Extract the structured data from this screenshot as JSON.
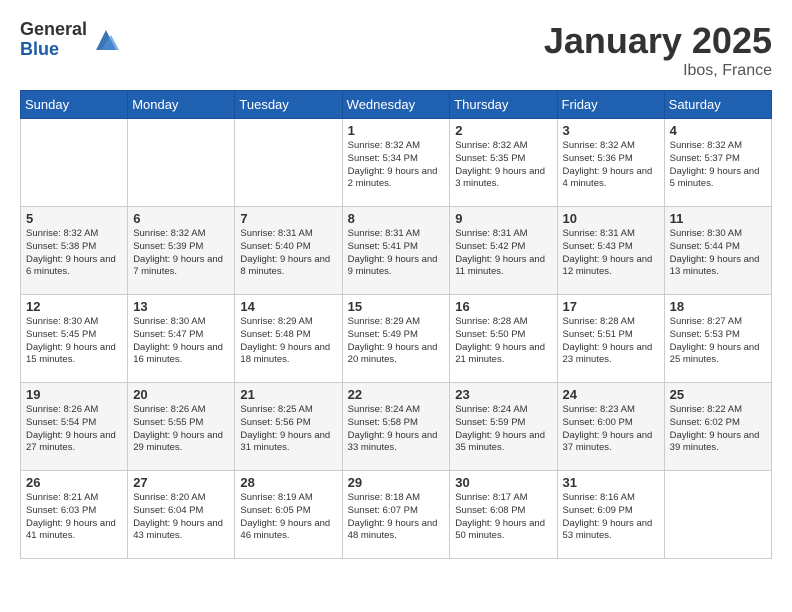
{
  "header": {
    "logo_general": "General",
    "logo_blue": "Blue",
    "month": "January 2025",
    "location": "Ibos, France"
  },
  "days_of_week": [
    "Sunday",
    "Monday",
    "Tuesday",
    "Wednesday",
    "Thursday",
    "Friday",
    "Saturday"
  ],
  "weeks": [
    [
      {
        "day": "",
        "info": ""
      },
      {
        "day": "",
        "info": ""
      },
      {
        "day": "",
        "info": ""
      },
      {
        "day": "1",
        "info": "Sunrise: 8:32 AM\nSunset: 5:34 PM\nDaylight: 9 hours\nand 2 minutes."
      },
      {
        "day": "2",
        "info": "Sunrise: 8:32 AM\nSunset: 5:35 PM\nDaylight: 9 hours\nand 3 minutes."
      },
      {
        "day": "3",
        "info": "Sunrise: 8:32 AM\nSunset: 5:36 PM\nDaylight: 9 hours\nand 4 minutes."
      },
      {
        "day": "4",
        "info": "Sunrise: 8:32 AM\nSunset: 5:37 PM\nDaylight: 9 hours\nand 5 minutes."
      }
    ],
    [
      {
        "day": "5",
        "info": "Sunrise: 8:32 AM\nSunset: 5:38 PM\nDaylight: 9 hours\nand 6 minutes."
      },
      {
        "day": "6",
        "info": "Sunrise: 8:32 AM\nSunset: 5:39 PM\nDaylight: 9 hours\nand 7 minutes."
      },
      {
        "day": "7",
        "info": "Sunrise: 8:31 AM\nSunset: 5:40 PM\nDaylight: 9 hours\nand 8 minutes."
      },
      {
        "day": "8",
        "info": "Sunrise: 8:31 AM\nSunset: 5:41 PM\nDaylight: 9 hours\nand 9 minutes."
      },
      {
        "day": "9",
        "info": "Sunrise: 8:31 AM\nSunset: 5:42 PM\nDaylight: 9 hours\nand 11 minutes."
      },
      {
        "day": "10",
        "info": "Sunrise: 8:31 AM\nSunset: 5:43 PM\nDaylight: 9 hours\nand 12 minutes."
      },
      {
        "day": "11",
        "info": "Sunrise: 8:30 AM\nSunset: 5:44 PM\nDaylight: 9 hours\nand 13 minutes."
      }
    ],
    [
      {
        "day": "12",
        "info": "Sunrise: 8:30 AM\nSunset: 5:45 PM\nDaylight: 9 hours\nand 15 minutes."
      },
      {
        "day": "13",
        "info": "Sunrise: 8:30 AM\nSunset: 5:47 PM\nDaylight: 9 hours\nand 16 minutes."
      },
      {
        "day": "14",
        "info": "Sunrise: 8:29 AM\nSunset: 5:48 PM\nDaylight: 9 hours\nand 18 minutes."
      },
      {
        "day": "15",
        "info": "Sunrise: 8:29 AM\nSunset: 5:49 PM\nDaylight: 9 hours\nand 20 minutes."
      },
      {
        "day": "16",
        "info": "Sunrise: 8:28 AM\nSunset: 5:50 PM\nDaylight: 9 hours\nand 21 minutes."
      },
      {
        "day": "17",
        "info": "Sunrise: 8:28 AM\nSunset: 5:51 PM\nDaylight: 9 hours\nand 23 minutes."
      },
      {
        "day": "18",
        "info": "Sunrise: 8:27 AM\nSunset: 5:53 PM\nDaylight: 9 hours\nand 25 minutes."
      }
    ],
    [
      {
        "day": "19",
        "info": "Sunrise: 8:26 AM\nSunset: 5:54 PM\nDaylight: 9 hours\nand 27 minutes."
      },
      {
        "day": "20",
        "info": "Sunrise: 8:26 AM\nSunset: 5:55 PM\nDaylight: 9 hours\nand 29 minutes."
      },
      {
        "day": "21",
        "info": "Sunrise: 8:25 AM\nSunset: 5:56 PM\nDaylight: 9 hours\nand 31 minutes."
      },
      {
        "day": "22",
        "info": "Sunrise: 8:24 AM\nSunset: 5:58 PM\nDaylight: 9 hours\nand 33 minutes."
      },
      {
        "day": "23",
        "info": "Sunrise: 8:24 AM\nSunset: 5:59 PM\nDaylight: 9 hours\nand 35 minutes."
      },
      {
        "day": "24",
        "info": "Sunrise: 8:23 AM\nSunset: 6:00 PM\nDaylight: 9 hours\nand 37 minutes."
      },
      {
        "day": "25",
        "info": "Sunrise: 8:22 AM\nSunset: 6:02 PM\nDaylight: 9 hours\nand 39 minutes."
      }
    ],
    [
      {
        "day": "26",
        "info": "Sunrise: 8:21 AM\nSunset: 6:03 PM\nDaylight: 9 hours\nand 41 minutes."
      },
      {
        "day": "27",
        "info": "Sunrise: 8:20 AM\nSunset: 6:04 PM\nDaylight: 9 hours\nand 43 minutes."
      },
      {
        "day": "28",
        "info": "Sunrise: 8:19 AM\nSunset: 6:05 PM\nDaylight: 9 hours\nand 46 minutes."
      },
      {
        "day": "29",
        "info": "Sunrise: 8:18 AM\nSunset: 6:07 PM\nDaylight: 9 hours\nand 48 minutes."
      },
      {
        "day": "30",
        "info": "Sunrise: 8:17 AM\nSunset: 6:08 PM\nDaylight: 9 hours\nand 50 minutes."
      },
      {
        "day": "31",
        "info": "Sunrise: 8:16 AM\nSunset: 6:09 PM\nDaylight: 9 hours\nand 53 minutes."
      },
      {
        "day": "",
        "info": ""
      }
    ]
  ]
}
